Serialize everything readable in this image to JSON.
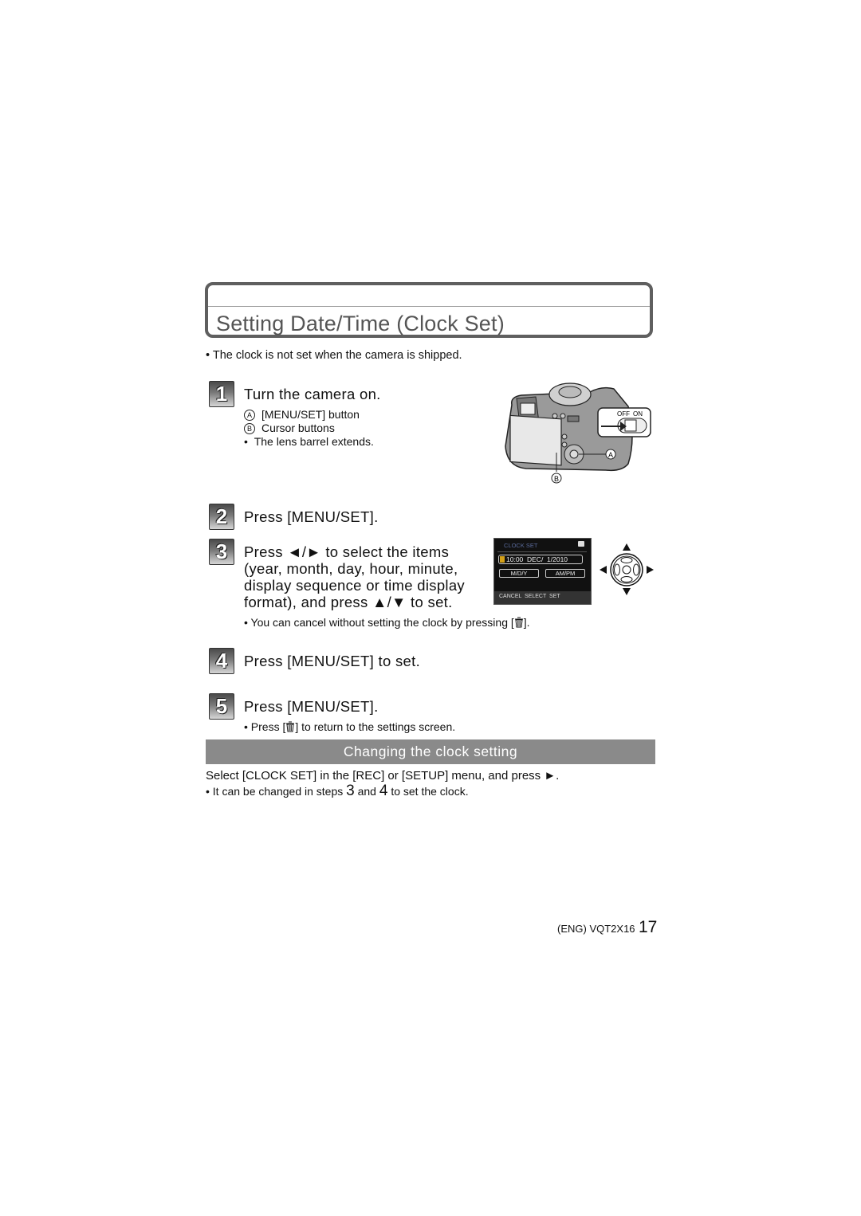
{
  "page": {
    "title": "Setting Date/Time (Clock Set)",
    "intro_note": "• The clock is not set when the camera is shipped."
  },
  "steps": [
    {
      "number": "1",
      "text": "Turn the camera on.",
      "sub": [
        {
          "marker": "A",
          "text": "[MENU/SET] button"
        },
        {
          "marker": "B",
          "text": "Cursor buttons"
        },
        {
          "marker": "•",
          "text": "The lens barrel extends."
        }
      ]
    },
    {
      "number": "2",
      "text": "Press [MENU/SET]."
    },
    {
      "number": "3",
      "lines": [
        "Press ◄/► to select the items",
        "(year, month, day, hour, minute,",
        "display sequence or time display",
        "format), and press ▲/▼ to set."
      ],
      "note_prefix": "• You can cancel without setting the clock by pressing [",
      "note_suffix": "]."
    },
    {
      "number": "4",
      "text": "Press [MENU/SET] to set."
    },
    {
      "number": "5",
      "text": "Press [MENU/SET].",
      "note_prefix": "• Press [",
      "note_suffix": "] to return to the settings screen."
    }
  ],
  "camera_illustration": {
    "callout_a": "A",
    "callout_b": "B",
    "switch_off": "OFF",
    "switch_on": "ON"
  },
  "clock_screen": {
    "header": "CLOCK SET",
    "datetime": "10:00  DEC/  1/2010",
    "format_order": "M/D/Y",
    "format_time": "AM/PM",
    "footer": "CANCEL  SELECT  SET"
  },
  "section": {
    "heading": "Changing the clock setting",
    "line1": "Select [CLOCK SET] in the [REC] or [SETUP] menu, and press ►.",
    "line2_a": "• It can be changed in steps ",
    "line2_step3": "3",
    "line2_b": " and ",
    "line2_step4": "4",
    "line2_c": " to set the clock."
  },
  "footer": {
    "code": "(ENG) VQT2X16",
    "page_number": "17"
  }
}
